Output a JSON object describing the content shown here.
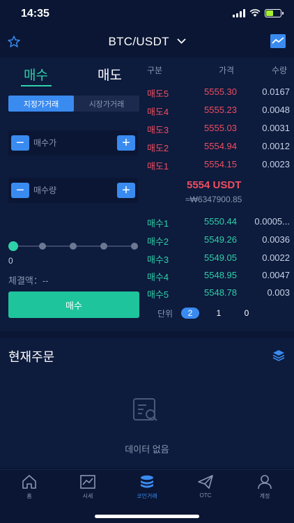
{
  "status_bar": {
    "time": "14:35"
  },
  "header": {
    "pair": "BTC/USDT"
  },
  "trade": {
    "tabs": {
      "buy": "매수",
      "sell": "매도"
    },
    "order_types": [
      "지정가거래",
      "시장가거래"
    ],
    "price_placeholder": "매수가",
    "amount_placeholder": "매수량",
    "slider_value": "0",
    "total_label": "체결액：--",
    "submit_label": "매수"
  },
  "orderbook": {
    "headers": {
      "type": "구분",
      "price": "가격",
      "qty": "수량"
    },
    "asks": [
      {
        "label": "매도5",
        "price": "5555.30",
        "qty": "0.0167"
      },
      {
        "label": "매도4",
        "price": "5555.23",
        "qty": "0.0048"
      },
      {
        "label": "매도3",
        "price": "5555.03",
        "qty": "0.0031"
      },
      {
        "label": "매도2",
        "price": "5554.94",
        "qty": "0.0012"
      },
      {
        "label": "매도1",
        "price": "5554.15",
        "qty": "0.0023"
      }
    ],
    "last_price": "5554 USDT",
    "last_price_krw": "≈₩6347900.85",
    "bids": [
      {
        "label": "매수1",
        "price": "5550.44",
        "qty": "0.0005..."
      },
      {
        "label": "매수2",
        "price": "5549.26",
        "qty": "0.0036"
      },
      {
        "label": "매수3",
        "price": "5549.05",
        "qty": "0.0022"
      },
      {
        "label": "매수4",
        "price": "5548.95",
        "qty": "0.0047"
      },
      {
        "label": "매수5",
        "price": "5548.78",
        "qty": "0.003"
      }
    ],
    "unit_label": "단위",
    "units": [
      "2",
      "1",
      "0"
    ]
  },
  "orders": {
    "title": "현재주문",
    "empty_text": "데이터 없음"
  },
  "nav": [
    {
      "label": "홈",
      "icon": "home-icon"
    },
    {
      "label": "시세",
      "icon": "chart-icon"
    },
    {
      "label": "코인거래",
      "icon": "coins-icon"
    },
    {
      "label": "OTC",
      "icon": "paper-plane-icon"
    },
    {
      "label": "계정",
      "icon": "user-icon"
    }
  ],
  "colors": {
    "accent": "#3a8bf0",
    "buy": "#2fd1a8",
    "sell": "#ef4e5f",
    "background": "#0a1633",
    "panel": "#0d1b3d"
  }
}
